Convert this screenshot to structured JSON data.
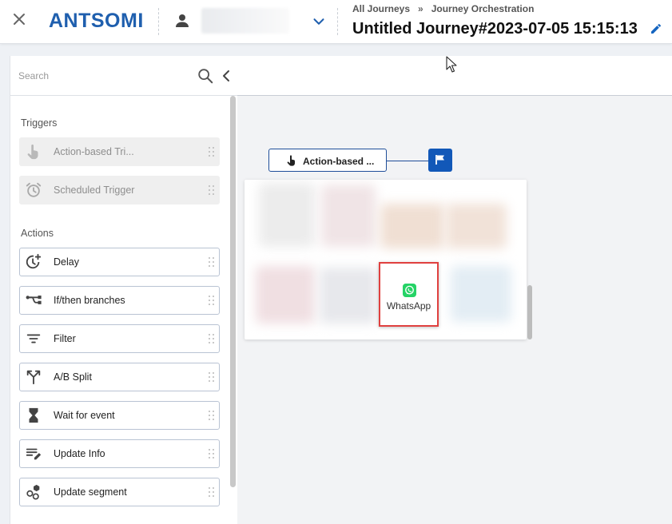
{
  "header": {
    "logo_text": "ANTSOMI",
    "breadcrumb": {
      "item1": "All Journeys",
      "separator": "»",
      "item2": "Journey Orchestration"
    },
    "title": "Untitled Journey#2023-07-05 15:15:13",
    "icons": [
      "close-icon",
      "account-icon",
      "chevron-down-icon",
      "edit-icon"
    ]
  },
  "sidebar": {
    "search": {
      "placeholder": "Search",
      "value": ""
    },
    "triggers_label": "Triggers",
    "triggers": [
      {
        "label": "Action-based Tri...",
        "icon": "pointer-hand-icon"
      },
      {
        "label": "Scheduled Trigger",
        "icon": "alarm-clock-icon"
      }
    ],
    "actions_label": "Actions",
    "actions": [
      {
        "label": "Delay",
        "icon": "delay-clock-icon"
      },
      {
        "label": "If/then branches",
        "icon": "branches-icon"
      },
      {
        "label": "Filter",
        "icon": "filter-icon"
      },
      {
        "label": "A/B Split",
        "icon": "ab-split-icon"
      },
      {
        "label": "Wait for event",
        "icon": "hourglass-icon"
      },
      {
        "label": "Update Info",
        "icon": "update-info-icon"
      },
      {
        "label": "Update segment",
        "icon": "segment-icon"
      }
    ]
  },
  "canvas": {
    "trigger_node": {
      "label": "Action-based ...",
      "icon": "pointer-hand-icon"
    },
    "start_node": {
      "icon": "flag-icon"
    },
    "channel_picker": {
      "highlighted_channel": {
        "label": "WhatsApp",
        "icon": "whatsapp-icon",
        "color": "#25d366"
      }
    }
  },
  "colors": {
    "brand_blue": "#1f5fae",
    "accent_blue": "#1258b8",
    "highlight_red": "#e0403f",
    "edit_icon": "#1565c0"
  }
}
